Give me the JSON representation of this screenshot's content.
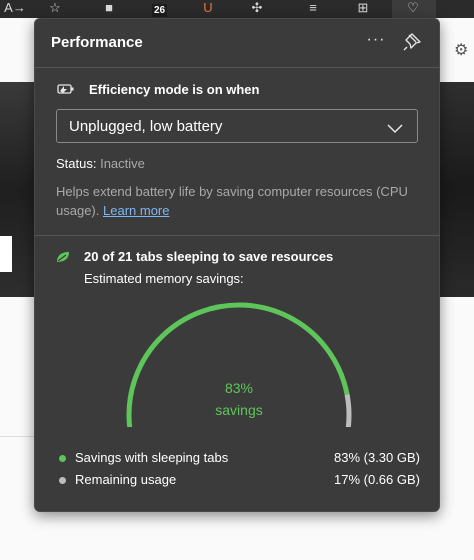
{
  "toolbar": {
    "read_aloud_label": "A→",
    "badge_count": "26"
  },
  "panel": {
    "title": "Performance",
    "more_label": "···"
  },
  "efficiency": {
    "heading": "Efficiency mode is on when",
    "selected_option": "Unplugged, low battery",
    "status_label": "Status:",
    "status_value": "Inactive",
    "help_text": "Helps extend battery life by saving computer resources (CPU usage).",
    "learn_more": "Learn more"
  },
  "sleeping_tabs": {
    "heading": "20 of 21 tabs sleeping to save resources",
    "estimated_label": "Estimated memory savings:",
    "gauge_percent": "83%",
    "gauge_label": "savings",
    "gauge_fraction": 0.83
  },
  "legend": [
    {
      "label": "Savings with sleeping tabs",
      "value": "83% (3.30 GB)",
      "color": "#5ec55a"
    },
    {
      "label": "Remaining usage",
      "value": "17% (0.66 GB)",
      "color": "#bdbdbd"
    }
  ],
  "colors": {
    "savings": "#5ec55a",
    "remaining": "#bdbdbd",
    "link": "#7fb6f0"
  }
}
